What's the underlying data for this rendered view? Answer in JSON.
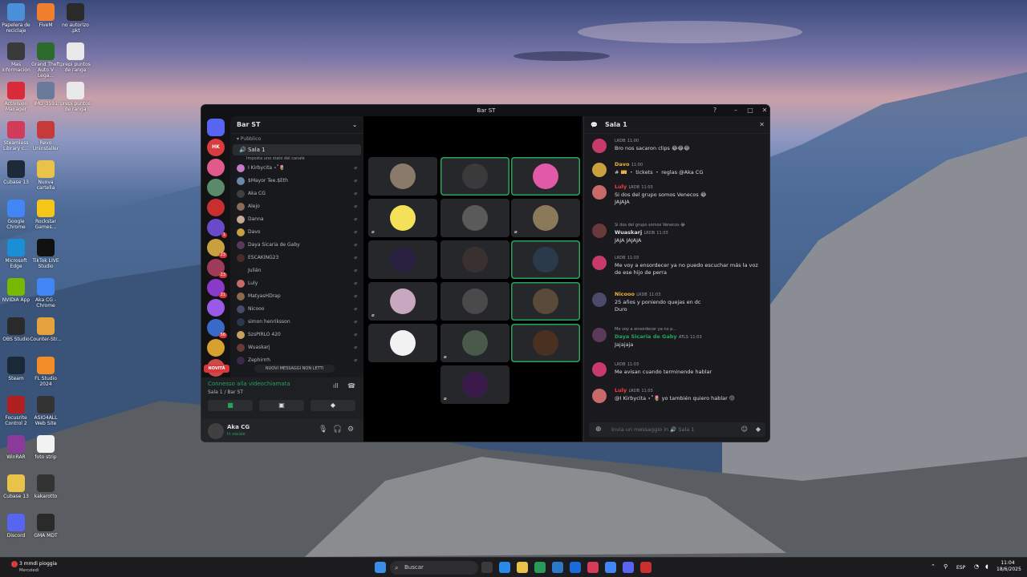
{
  "desktop": {
    "icons": [
      {
        "label": "Papelera de reciclaje",
        "color": "#4a90d9"
      },
      {
        "label": "FiveM",
        "color": "#f08030"
      },
      {
        "label": "no autorizo .pkt",
        "color": "#2a2a2a"
      },
      {
        "label": "Mas información",
        "color": "#3a3a3a"
      },
      {
        "label": "Grand Theft Auto V Lega...",
        "color": "#2d6b2d"
      },
      {
        "label": "prepi puntos de ranga",
        "color": "#e8e8e8"
      },
      {
        "label": "Activision Manager",
        "color": "#d92b3a"
      },
      {
        "label": "IMG_3591",
        "color": "#6a7a9a"
      },
      {
        "label": "prepi puntos de ranga",
        "color": "#e8e8e8"
      },
      {
        "label": "Steamless Library c...",
        "color": "#d23b5a"
      },
      {
        "label": "Revo Uninstaller",
        "color": "#c83a3a"
      },
      {
        "label": "Cubase 13",
        "color": "#1e2a3a"
      },
      {
        "label": "Nuova cartella",
        "color": "#e9c24a"
      },
      {
        "label": "Google Chrome",
        "color": "#4285f4"
      },
      {
        "label": "Rockstar Games...",
        "color": "#f5c518"
      },
      {
        "label": "Microsoft Edge",
        "color": "#1a8fd6"
      },
      {
        "label": "TikTok LIVE Studio",
        "color": "#111111"
      },
      {
        "label": "NVIDIA App",
        "color": "#76b900"
      },
      {
        "label": "Aka CG - Chrome",
        "color": "#4285f4"
      },
      {
        "label": "OBS Studio",
        "color": "#2a2a2a"
      },
      {
        "label": "Counter-Str...",
        "color": "#e6a23c"
      },
      {
        "label": "Steam",
        "color": "#1b2838"
      },
      {
        "label": "FL Studio 2024",
        "color": "#f28c28"
      },
      {
        "label": "Focusrite Control 2",
        "color": "#b02020"
      },
      {
        "label": "ASIO4ALL Web Site",
        "color": "#333333"
      },
      {
        "label": "WinRAR",
        "color": "#8a3a9a"
      },
      {
        "label": "foto strip",
        "color": "#f2f2f2"
      },
      {
        "label": "Cubase 13",
        "color": "#e9c24a"
      },
      {
        "label": "kakarotto",
        "color": "#333333"
      },
      {
        "label": "Discord",
        "color": "#5865f2"
      },
      {
        "label": "GMA MDT",
        "color": "#2a2a2a"
      }
    ]
  },
  "window": {
    "title": "Bar ST",
    "help_icon": "?",
    "minimize": "–",
    "maximize": "□",
    "close": "✕"
  },
  "servers": [
    {
      "label": "HK",
      "color": "#d83c3c",
      "badge": ""
    },
    {
      "label": "",
      "color": "#e05a8a",
      "badge": ""
    },
    {
      "label": "",
      "color": "#5b8a6a",
      "badge": ""
    },
    {
      "label": "",
      "color": "#c83030",
      "badge": ""
    },
    {
      "label": "",
      "color": "#6a4ac8",
      "badge": "1"
    },
    {
      "label": "",
      "color": "#c8a040",
      "badge": "23"
    },
    {
      "label": "",
      "color": "#a03a5a",
      "badge": "23"
    },
    {
      "label": "",
      "color": "#8a3ac8",
      "badge": "21"
    },
    {
      "label": "",
      "color": "#9a5ae8",
      "badge": ""
    },
    {
      "label": "",
      "color": "#3a6ac8",
      "badge": "56"
    },
    {
      "label": "",
      "color": "#d8a030",
      "badge": ""
    },
    {
      "label": "",
      "color": "#c84a4a",
      "badge": ""
    }
  ],
  "novita": "NOVITÀ",
  "channels": {
    "server_name": "Bar ST",
    "category": "Pubblico",
    "voice_channel": "Sala 1",
    "voice_status": "Imposta uno stato del canale",
    "members": [
      {
        "name": "I Kirbycita ⋆˚🌷",
        "color": "#c87ac8"
      },
      {
        "name": "$Mayor Tee.$Eth",
        "color": "#6a8aa8"
      },
      {
        "name": "Aka CG",
        "color": "#404040"
      },
      {
        "name": "Alejo",
        "color": "#8a6a5a"
      },
      {
        "name": "Danna",
        "color": "#c8a890"
      },
      {
        "name": "Davo",
        "color": "#c8a040"
      },
      {
        "name": "Daya Sicaria de Gaby",
        "color": "#5a3a5a"
      },
      {
        "name": "ESCAKING23",
        "color": "#4a2a2a"
      },
      {
        "name": "Julián",
        "color": "#1a1a1a"
      },
      {
        "name": "Luly",
        "color": "#c86a6a"
      },
      {
        "name": "MatyasHDrap",
        "color": "#8a6a4a"
      },
      {
        "name": "Nicooo",
        "color": "#4a4a6a"
      },
      {
        "name": "simon henriksson",
        "color": "#2a3a4a"
      },
      {
        "name": "SzsPIRLO 420",
        "color": "#c8a060"
      },
      {
        "name": "Wuaskarj",
        "color": "#6a3a3a"
      },
      {
        "name": "Zephirrrh",
        "color": "#3a2a4a"
      }
    ],
    "new_messages": "NUOVI MESSAGGI NON LETTI"
  },
  "voice_panel": {
    "status": "Connesso alla videochiamata",
    "location": "Sala 1 / Bar ST"
  },
  "user": {
    "name": "Aka CG",
    "status": "In vocale"
  },
  "stage": {
    "tiles": [
      {
        "color": "#8a7a6a",
        "speaking": false,
        "muted": false
      },
      {
        "color": "#3a3a3a",
        "speaking": true,
        "muted": false
      },
      {
        "color": "#e05aa8",
        "speaking": true,
        "muted": false
      },
      {
        "color": "#f5e05a",
        "speaking": false,
        "muted": true
      },
      {
        "color": "#5a5a5a",
        "speaking": false,
        "muted": false
      },
      {
        "color": "#8a7a5a",
        "speaking": false,
        "muted": true
      },
      {
        "color": "#2a2040",
        "speaking": false,
        "muted": false
      },
      {
        "color": "#3a3030",
        "speaking": false,
        "muted": false
      },
      {
        "color": "#2a3a4a",
        "speaking": true,
        "muted": false
      },
      {
        "color": "#c8a8c0",
        "speaking": false,
        "muted": true
      },
      {
        "color": "#4a4a4a",
        "speaking": false,
        "muted": false
      },
      {
        "color": "#5a4a3a",
        "speaking": true,
        "muted": false
      },
      {
        "color": "#f2f2f2",
        "speaking": false,
        "muted": false
      },
      {
        "color": "#4a5a4a",
        "speaking": false,
        "muted": true
      },
      {
        "color": "#4a3020",
        "speaking": true,
        "muted": false
      },
      {
        "color": "#3a1a4a",
        "speaking": false,
        "muted": true
      }
    ]
  },
  "chat": {
    "channel": "Sala 1",
    "placeholder": "Invia un messaggio in 🔊 Sala 1",
    "messages": [
      {
        "name": "",
        "time": "11:00",
        "role": "LRDB",
        "text": "Bro nos sacaron clips 😂😂😂",
        "color": "#c83a6a",
        "name_color": "#dbdee1"
      },
      {
        "name": "Davo",
        "time": "11:00",
        "role": "",
        "text": "# 🎫 ・ tickets ・ reglas @Aka CG",
        "color": "#c8a040",
        "name_color": "#f0b232"
      },
      {
        "name": "Luly",
        "time": "11:03",
        "role": "LRDB",
        "text": "Si dos del grupo somos Venecos 😂",
        "text2": "JAJAJA",
        "color": "#c86a6a",
        "name_color": "#f23f43"
      },
      {
        "name": "Wuaskarj",
        "time": "11:03",
        "role": "LRDB",
        "reply": "Si dos del grupo somos Venecos 😂",
        "text": "JAJA JAJAJA",
        "color": "#6a3a3a",
        "name_color": "#dbdee1"
      },
      {
        "name": "",
        "time": "11:03",
        "role": "LRDB",
        "text": "Me voy a ensordecer ya no puedo escuchar más la voz de ese hijo de perra",
        "color": "#c83a6a",
        "name_color": "#dbdee1"
      },
      {
        "name": "Nicooo",
        "time": "11:03",
        "role": "LRDB",
        "text": "25 años y poniendo quejas en dc",
        "text2": "Duro",
        "color": "#4a4a6a",
        "name_color": "#f0b232"
      },
      {
        "name": "Daya Sicaria de Gaby",
        "time": "11:03",
        "role": "ATLS",
        "reply": "Me voy a ensordecer ya no p...",
        "text": "Jajajaja",
        "color": "#5a3a5a",
        "name_color": "#23a55a"
      },
      {
        "name": "",
        "time": "11:03",
        "role": "LRDB",
        "text": "Me avisan cuando terminende hablar",
        "color": "#c83a6a",
        "name_color": "#dbdee1"
      },
      {
        "name": "Luly",
        "time": "11:03",
        "role": "LRDB",
        "text": "@I Kirbycita ⋆˚🌷 yo también quiero hablar 😔",
        "color": "#c86a6a",
        "name_color": "#f23f43"
      }
    ]
  },
  "taskbar": {
    "weather": "3 mmdi pioggia",
    "weather_sub": "Mercoledì",
    "search": "Buscar",
    "lang": "ESP",
    "time": "11:04",
    "date": "18/6/2025"
  }
}
